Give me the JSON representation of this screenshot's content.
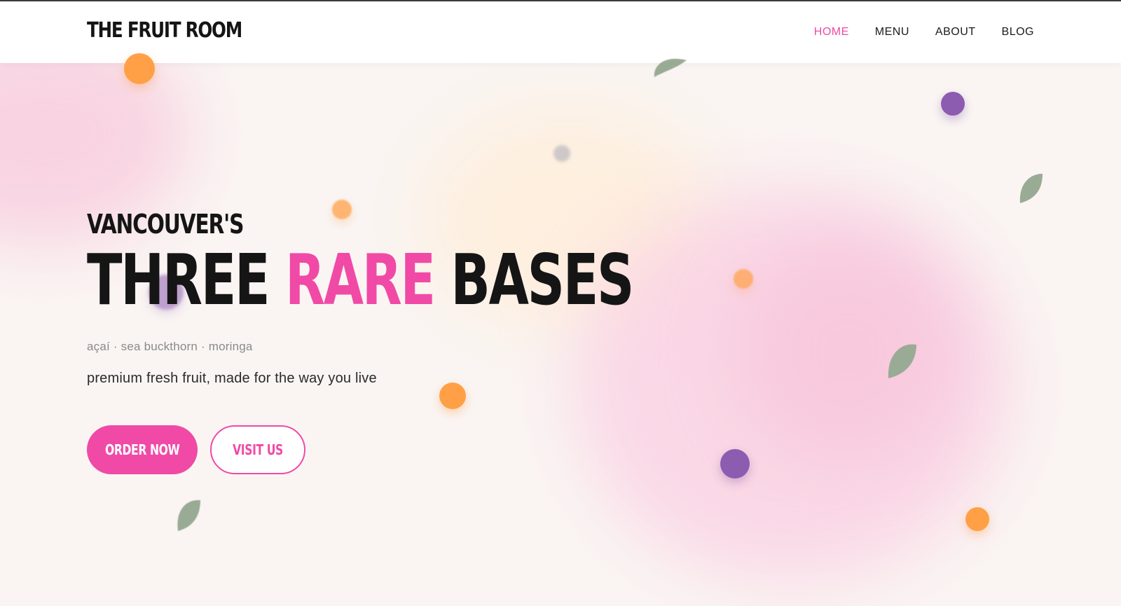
{
  "brand": {
    "name": "THE FRUIT ROOM"
  },
  "nav": {
    "items": [
      {
        "label": "HOME",
        "active": true
      },
      {
        "label": "MENU",
        "active": false
      },
      {
        "label": "ABOUT",
        "active": false
      },
      {
        "label": "BLOG",
        "active": false
      }
    ]
  },
  "hero": {
    "eyebrow": "VANCOUVER'S",
    "headline": {
      "part1": "THREE",
      "accent": "RARE",
      "part2": "BASES"
    },
    "ingredients": "açaí · sea buckthorn · moringa",
    "tagline": "premium fresh fruit, made for the way you live",
    "primary_button": "ORDER NOW",
    "secondary_button": "VISIT US"
  },
  "colors": {
    "accent": "#f04aa6",
    "text": "#151515",
    "background": "#faf5f3",
    "orange_berry": "#ffa046",
    "purple_berry": "#8c5cb0",
    "leaf": "#9aab95"
  }
}
